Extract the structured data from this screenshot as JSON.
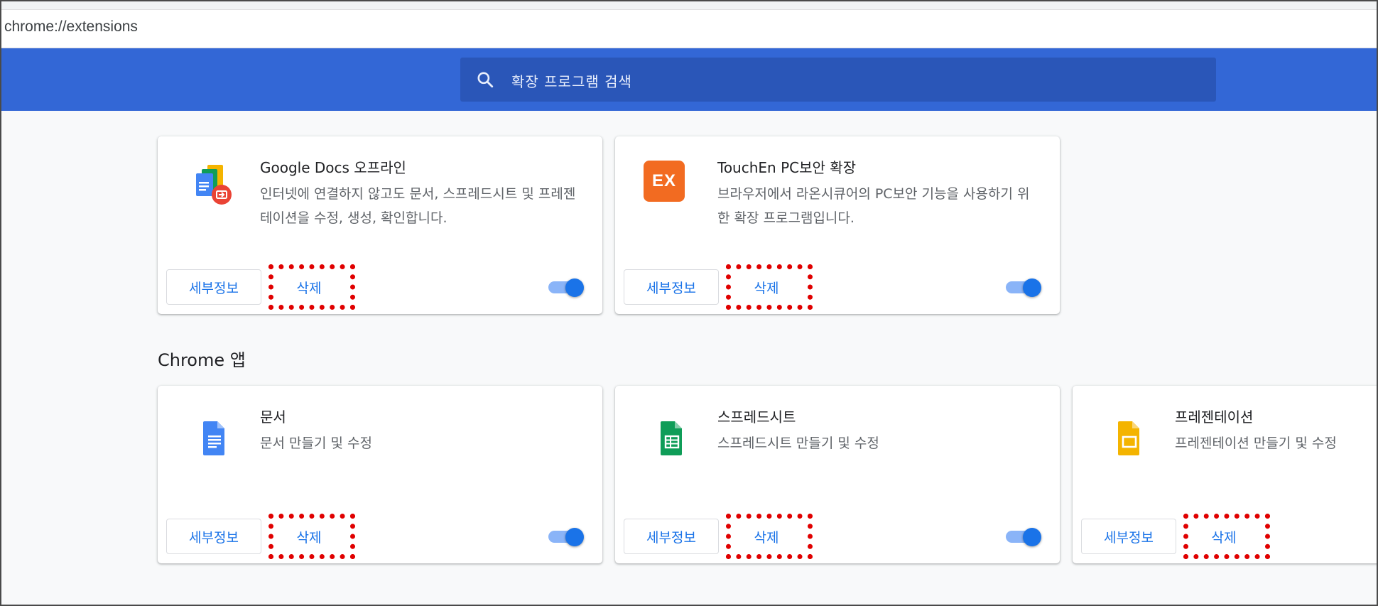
{
  "address_bar": {
    "url": "chrome://extensions"
  },
  "search": {
    "placeholder": "확장 프로그램 검색"
  },
  "extensions": [
    {
      "name": "Google Docs 오프라인",
      "description": "인터넷에 연결하지 않고도 문서, 스프레드시트 및 프레젠테이션을 수정, 생성, 확인합니다.",
      "details_label": "세부정보",
      "remove_label": "삭제",
      "enabled": true,
      "icon": "google-docs-offline-icon"
    },
    {
      "name": "TouchEn PC보안 확장",
      "description": "브라우저에서 라온시큐어의 PC보안 기능을 사용하기 위한 확장 프로그램입니다.",
      "details_label": "세부정보",
      "remove_label": "삭제",
      "enabled": true,
      "icon": "touchen-ex-icon",
      "icon_text": "EX"
    }
  ],
  "apps_section": {
    "title": "Chrome 앱"
  },
  "apps": [
    {
      "name": "문서",
      "description": "문서 만들기 및 수정",
      "details_label": "세부정보",
      "remove_label": "삭제",
      "enabled": true,
      "icon": "google-docs-icon"
    },
    {
      "name": "스프레드시트",
      "description": "스프레드시트 만들기 및 수정",
      "details_label": "세부정보",
      "remove_label": "삭제",
      "enabled": true,
      "icon": "google-sheets-icon"
    },
    {
      "name": "프레젠테이션",
      "description": "프레젠테이션 만들기 및 수정",
      "details_label": "세부정보",
      "remove_label": "삭제",
      "enabled": false,
      "icon": "google-slides-icon"
    }
  ],
  "colors": {
    "header": "#3367d6",
    "accent": "#1a73e8",
    "highlight": "#e00000"
  }
}
